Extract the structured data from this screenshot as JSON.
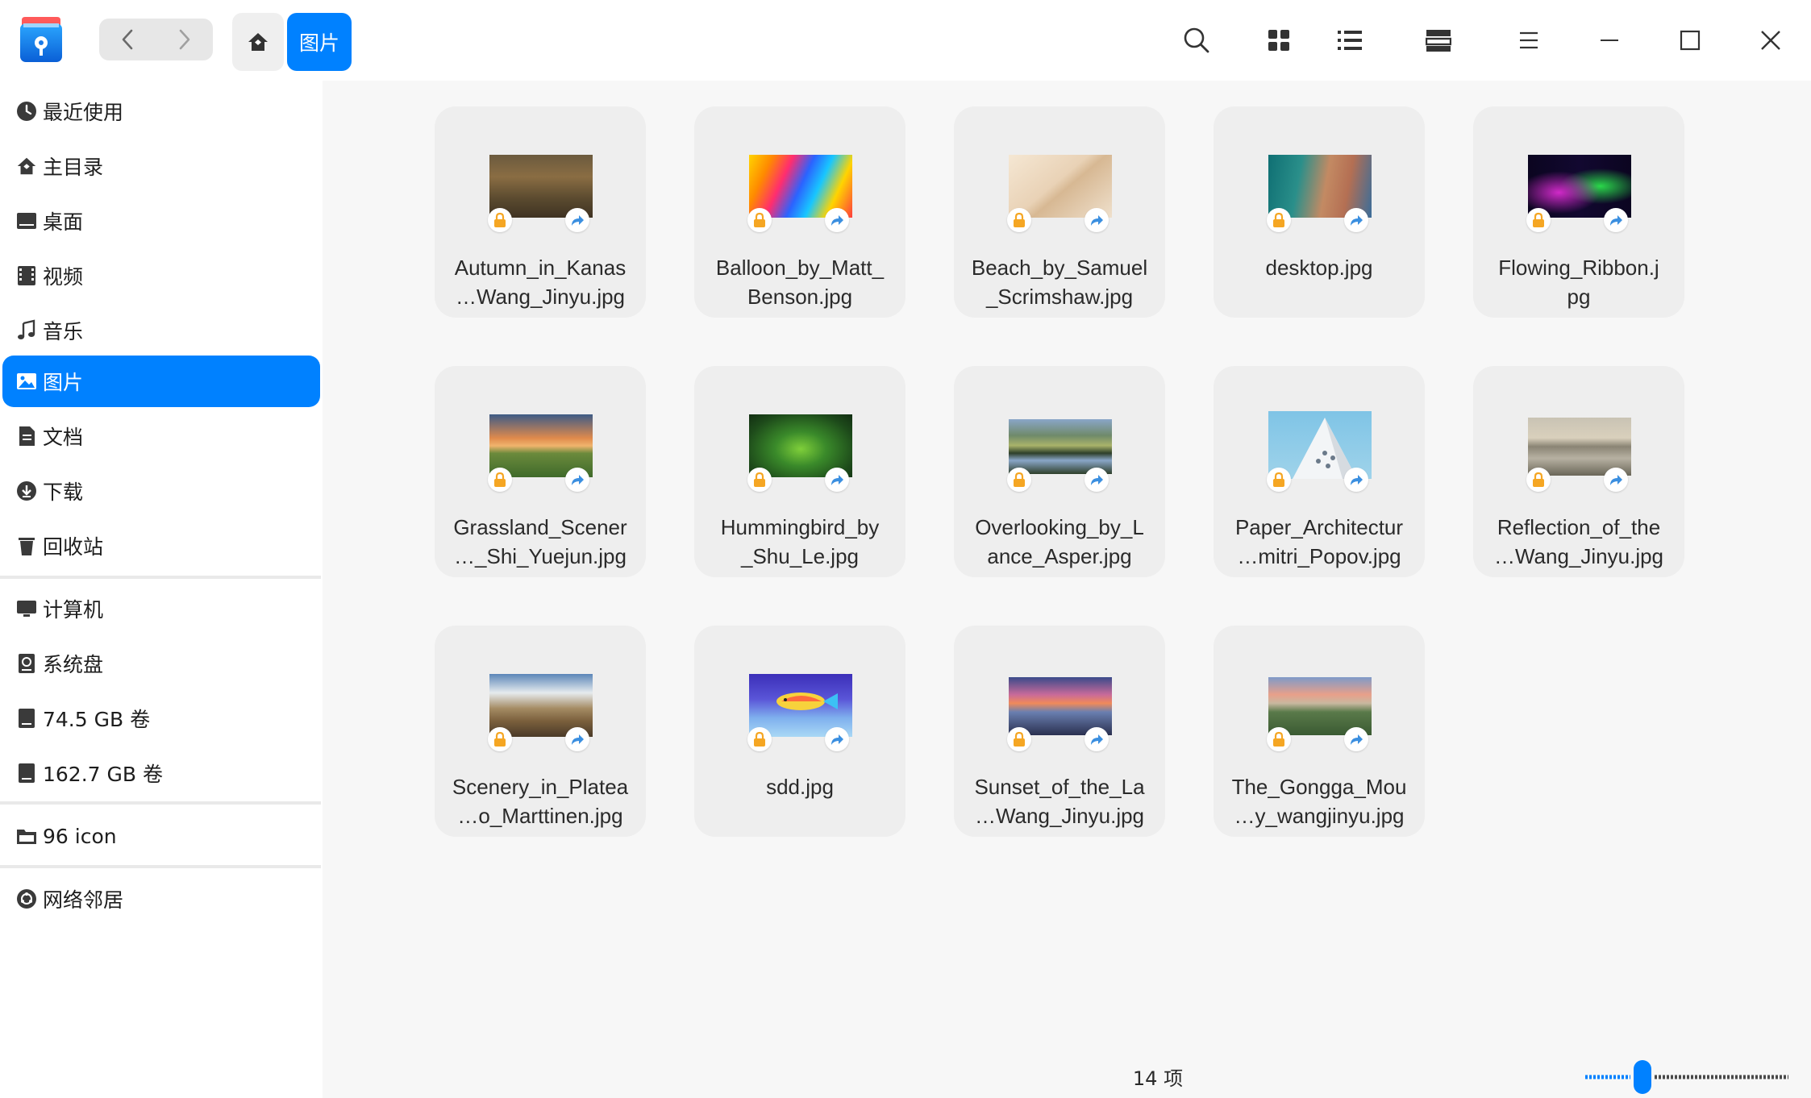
{
  "titlebar": {
    "breadcrumb_current": "图片",
    "icons": {
      "app": "file-manager-logo-icon",
      "back": "chevron-left-icon",
      "forward": "chevron-right-icon",
      "home": "home-icon",
      "search": "search-icon",
      "grid_view": "grid-view-icon",
      "list_view": "list-view-icon",
      "detail_view": "split-view-icon",
      "menu": "hamburger-menu-icon",
      "minimize": "minimize-icon",
      "maximize": "maximize-icon",
      "close": "close-icon"
    }
  },
  "sidebar": {
    "items": [
      {
        "label": "最近使用",
        "icon": "clock-icon"
      },
      {
        "label": "主目录",
        "icon": "home-icon"
      },
      {
        "label": "桌面",
        "icon": "desktop-icon"
      },
      {
        "label": "视频",
        "icon": "film-icon"
      },
      {
        "label": "音乐",
        "icon": "music-note-icon"
      },
      {
        "label": "图片",
        "icon": "image-icon",
        "active": true
      },
      {
        "label": "文档",
        "icon": "document-icon"
      },
      {
        "label": "下载",
        "icon": "download-icon"
      },
      {
        "label": "回收站",
        "icon": "trash-icon"
      },
      {
        "label": "计算机",
        "icon": "computer-icon"
      },
      {
        "label": "系统盘",
        "icon": "system-disk-icon"
      },
      {
        "label": "74.5 GB 卷",
        "icon": "drive-icon"
      },
      {
        "label": "162.7 GB 卷",
        "icon": "drive-icon"
      },
      {
        "label": "96 icon",
        "icon": "folder-icon"
      },
      {
        "label": "网络邻居",
        "icon": "network-icon"
      }
    ]
  },
  "files": [
    {
      "line1": "Autumn_in_Kanas",
      "line2": "…Wang_Jinyu.jpg",
      "thumb": "autumn-forest"
    },
    {
      "line1": "Balloon_by_Matt_",
      "line2": "Benson.jpg",
      "thumb": "balloon"
    },
    {
      "line1": "Beach_by_Samuel",
      "line2": "_Scrimshaw.jpg",
      "thumb": "sand"
    },
    {
      "line1": "desktop.jpg",
      "line2": "",
      "thumb": "desktop"
    },
    {
      "line1": "Flowing_Ribbon.j",
      "line2": "pg",
      "thumb": "ribbon"
    },
    {
      "line1": "Grassland_Scener",
      "line2": "…_Shi_Yuejun.jpg",
      "thumb": "grassland"
    },
    {
      "line1": "Hummingbird_by",
      "line2": "_Shu_Le.jpg",
      "thumb": "hummingbird"
    },
    {
      "line1": "Overlooking_by_L",
      "line2": "ance_Asper.jpg",
      "thumb": "overlooking"
    },
    {
      "line1": "Paper_Architectur",
      "line2": "…mitri_Popov.jpg",
      "thumb": "paper-arch"
    },
    {
      "line1": "Reflection_of_the",
      "line2": "…Wang_Jinyu.jpg",
      "thumb": "reflection"
    },
    {
      "line1": "Scenery_in_Platea",
      "line2": "…o_Marttinen.jpg",
      "thumb": "plateau"
    },
    {
      "line1": "sdd.jpg",
      "line2": "",
      "thumb": "fish"
    },
    {
      "line1": "Sunset_of_the_La",
      "line2": "…Wang_Jinyu.jpg",
      "thumb": "sunset"
    },
    {
      "line1": "The_Gongga_Mou",
      "line2": "…y_wangjinyu.jpg",
      "thumb": "gongga"
    }
  ],
  "status": {
    "count": "14 项"
  },
  "zoom": {
    "level": 0.3
  },
  "colors": {
    "accent": "#0081ff",
    "lock_badge": "#f5a623",
    "link_badge": "#3b8fe0"
  }
}
